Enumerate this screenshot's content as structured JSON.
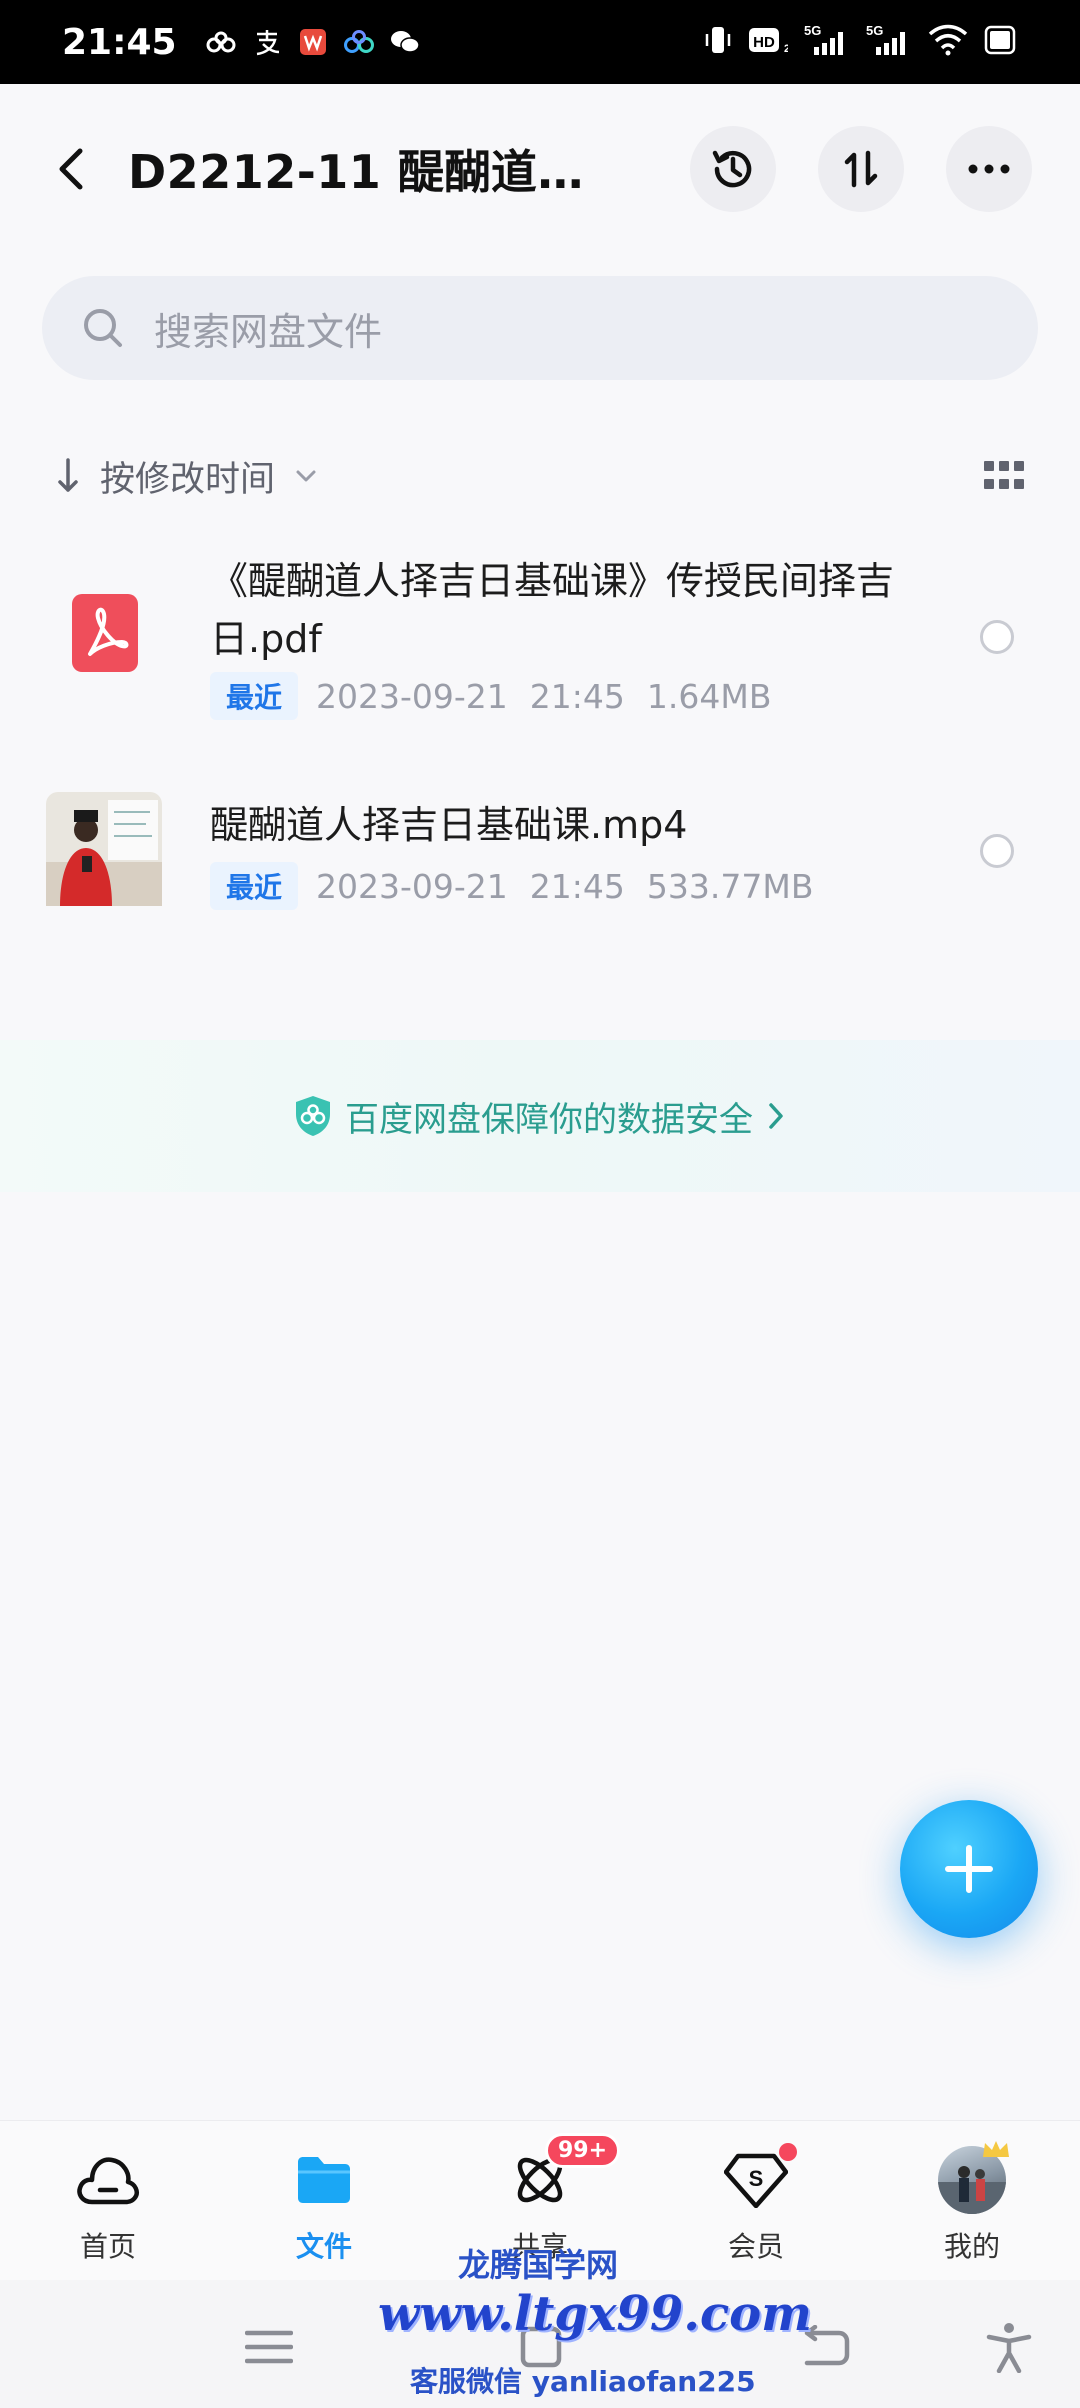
{
  "status_bar": {
    "time": "21:45",
    "icons": [
      "baidu-netdisk-icon",
      "alipay-icon",
      "wps-icon",
      "baidu-app-icon",
      "wechat-icon",
      "vibrate-icon",
      "hd-icon",
      "signal-5g-icon",
      "signal-5g-icon",
      "wifi-icon",
      "battery-icon"
    ],
    "net1": "5G",
    "net2": "5G",
    "hd": "HD"
  },
  "header": {
    "title": "D2212-11 醍醐道…",
    "actions": [
      "history-icon",
      "sort-transfer-icon",
      "more-icon"
    ]
  },
  "search": {
    "placeholder": "搜索网盘文件"
  },
  "sort": {
    "label": "按修改时间"
  },
  "files": [
    {
      "name": "《醍醐道人择吉日基础课》传授民间择吉日.pdf",
      "badge": "最近",
      "date": "2023-09-21",
      "time": "21:45",
      "size": "1.64MB",
      "type": "pdf"
    },
    {
      "name": "醍醐道人择吉日基础课.mp4",
      "badge": "最近",
      "date": "2023-09-21",
      "time": "21:45",
      "size": "533.77MB",
      "type": "video"
    }
  ],
  "safety_banner": {
    "text": "百度网盘保障你的数据安全"
  },
  "bottom_nav": {
    "items": [
      {
        "label": "首页",
        "icon": "cloud-home-icon",
        "active": false
      },
      {
        "label": "文件",
        "icon": "folder-icon",
        "active": true
      },
      {
        "label": "共享",
        "icon": "share-atom-icon",
        "active": false,
        "badge": "99+"
      },
      {
        "label": "会员",
        "icon": "vip-diamond-icon",
        "active": false
      },
      {
        "label": "我的",
        "icon": "avatar",
        "active": false
      }
    ]
  },
  "watermark": {
    "line1": "龙腾国学网",
    "line2": "www.ltgx99.com",
    "line3": "客服微信 yanliaofan225"
  },
  "colors": {
    "accent": "#1a8ff0",
    "badge_bg": "#eaf3fe",
    "badge_text": "#1f76e8",
    "pdf_red": "#ef4e5b",
    "safety_green": "#2a9d8f",
    "notif_red": "#f5475d"
  }
}
